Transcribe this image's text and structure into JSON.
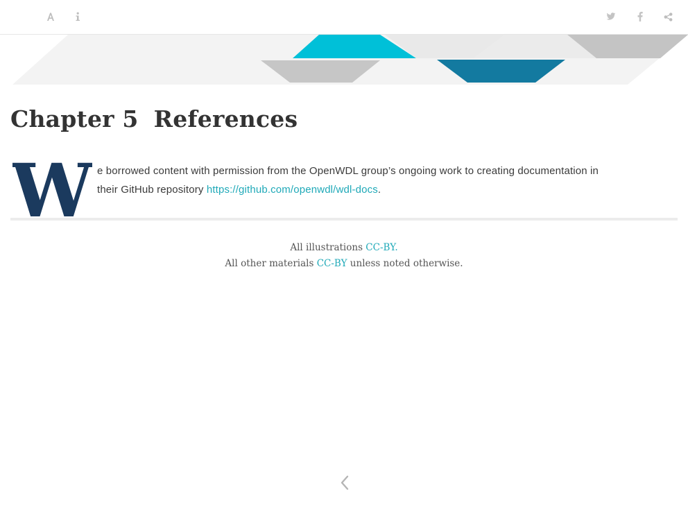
{
  "toolbar": {
    "left_icons": [
      "font-settings-icon",
      "info-icon"
    ],
    "right_icons": [
      "twitter-icon",
      "facebook-icon",
      "share-icon"
    ]
  },
  "banner": {
    "colors": {
      "cyan": "#00c0d8",
      "teal_dark": "#137aa0",
      "gray_mid": "#c4c4c4",
      "gray_light": "#ececec",
      "gray_pale": "#f3f3f3"
    }
  },
  "chapter": {
    "number": "Chapter 5",
    "title": "References"
  },
  "content": {
    "drop_cap": "W",
    "line1": "e borrowed content with permission from the OpenWDL group’s ongoing work to creating documentation in",
    "line2_prefix": "their GitHub repository ",
    "link_text": "https://github.com/openwdl/wdl-docs",
    "line2_suffix": "."
  },
  "footer": {
    "illustrations_prefix": "All illustrations ",
    "illustrations_license": "CC-BY.",
    "materials_prefix": "All other materials ",
    "materials_license": "CC-BY",
    "materials_suffix": " unless noted otherwise."
  },
  "navigation": {
    "prev_icon": "chevron-left-icon"
  },
  "colors": {
    "link": "#1fa9b8",
    "dropcap": "#1b3a5e",
    "text": "#333333"
  }
}
